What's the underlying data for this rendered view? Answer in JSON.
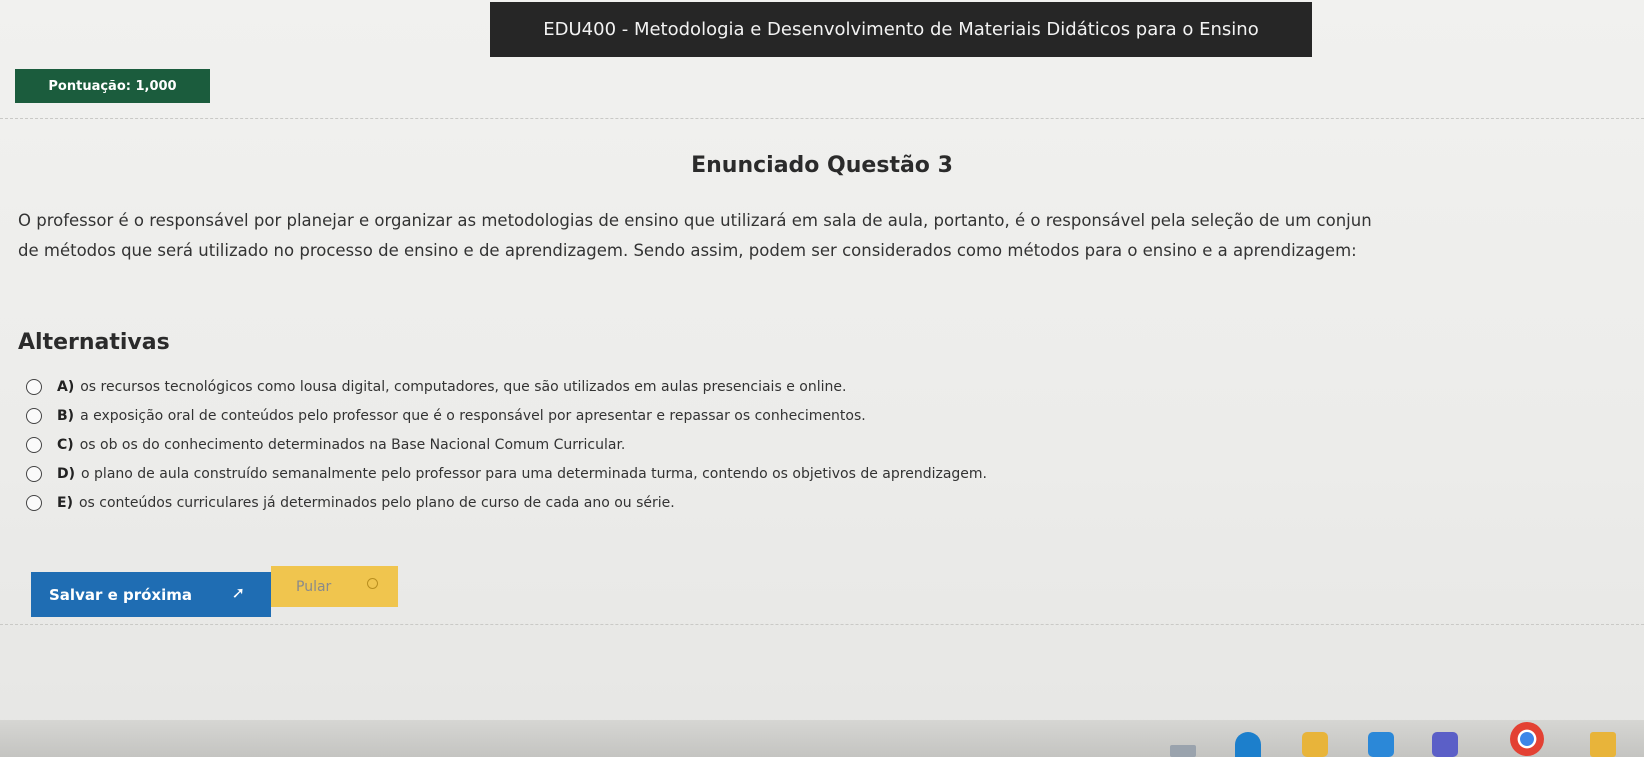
{
  "header": {
    "course_title": "EDU400 - Metodologia e Desenvolvimento de Materiais Didáticos para o Ensino",
    "score_label": "Pontuação: 1,000"
  },
  "question": {
    "title": "Enunciado Questão 3",
    "statement_lines": [
      "O professor é o responsável por planejar e organizar as metodologias de ensino que utilizará em sala de aula, portanto, é o responsável pela seleção de um conjun",
      "de métodos que será utilizado no processo de ensino e de aprendizagem. Sendo assim, podem ser considerados como métodos para o ensino e a aprendizagem:"
    ]
  },
  "alternatives": {
    "title": "Alternativas",
    "options": [
      {
        "letter": "A)",
        "text": "os recursos tecnológicos como lousa digital, computadores, que são utilizados em aulas presenciais e online."
      },
      {
        "letter": "B)",
        "text": "a exposição oral de conteúdos pelo professor que é o responsável por apresentar e repassar os conhecimentos."
      },
      {
        "letter": "C)",
        "text": "os ob  os do conhecimento determinados na Base Nacional Comum Curricular."
      },
      {
        "letter": "D)",
        "text": "o plano de aula construído semanalmente pelo professor para uma determinada turma, contendo os objetivos de aprendizagem."
      },
      {
        "letter": "E)",
        "text": "os conteúdos curriculares já determinados pelo plano de curso de cada ano ou série."
      }
    ]
  },
  "actions": {
    "save_label": "Salvar e próxima",
    "skip_label": "Pular"
  },
  "icons": {
    "save": "arrow-right-icon",
    "skip": "skip-circle-icon"
  },
  "colors": {
    "title_bar": "#262626",
    "score_badge": "#1b5c3d",
    "save_button": "#1f6db3",
    "skip_button": "#f0c54e"
  }
}
